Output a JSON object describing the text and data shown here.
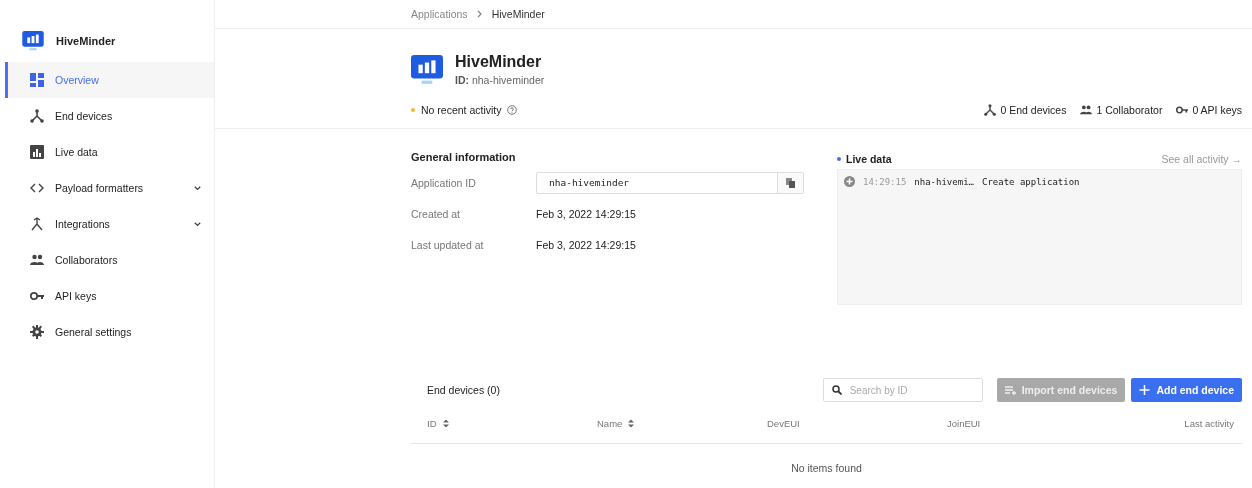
{
  "sidebar": {
    "app_name": "HiveMinder",
    "items": [
      {
        "label": "Overview",
        "kind": "link",
        "selected": true
      },
      {
        "label": "End devices",
        "kind": "link",
        "selected": false
      },
      {
        "label": "Live data",
        "kind": "link",
        "selected": false
      },
      {
        "label": "Payload formatters",
        "kind": "group",
        "selected": false
      },
      {
        "label": "Integrations",
        "kind": "group",
        "selected": false
      },
      {
        "label": "Collaborators",
        "kind": "link",
        "selected": false
      },
      {
        "label": "API keys",
        "kind": "link",
        "selected": false
      },
      {
        "label": "General settings",
        "kind": "link",
        "selected": false
      }
    ]
  },
  "breadcrumb": [
    "Applications",
    "HiveMinder"
  ],
  "header": {
    "title": "HiveMinder",
    "id_label": "ID:",
    "id_value": "nha-hiveminder",
    "activity": "No recent activity",
    "stats": [
      "0 End devices",
      "1 Collaborator",
      "0 API keys"
    ]
  },
  "general_information": {
    "title": "General information",
    "rows": [
      {
        "label": "Application ID",
        "value": "nha-hiveminder",
        "kind": "copy"
      },
      {
        "label": "Created at",
        "value": "Feb 3, 2022 14:29:15",
        "kind": "text"
      },
      {
        "label": "Last updated at",
        "value": "Feb 3, 2022 14:29:15",
        "kind": "text"
      }
    ]
  },
  "live_data": {
    "title": "Live data",
    "link": "See all activity →",
    "events": [
      {
        "time": "14:29:15",
        "entity": "nha-hivemi…",
        "message": "Create application"
      }
    ]
  },
  "end_devices": {
    "title": "End devices (0)",
    "search": {
      "placeholder": "Search by ID"
    },
    "import_button": "Import end devices",
    "import_disabled": true,
    "add_button": "Add end device",
    "columns": [
      {
        "label": "ID",
        "sortable": true
      },
      {
        "label": "Name",
        "sortable": true
      },
      {
        "label": "DevEUI",
        "sortable": false
      },
      {
        "label": "JoinEUI",
        "sortable": false
      },
      {
        "label": "Last activity",
        "sortable": false
      }
    ],
    "empty": "No items found"
  }
}
